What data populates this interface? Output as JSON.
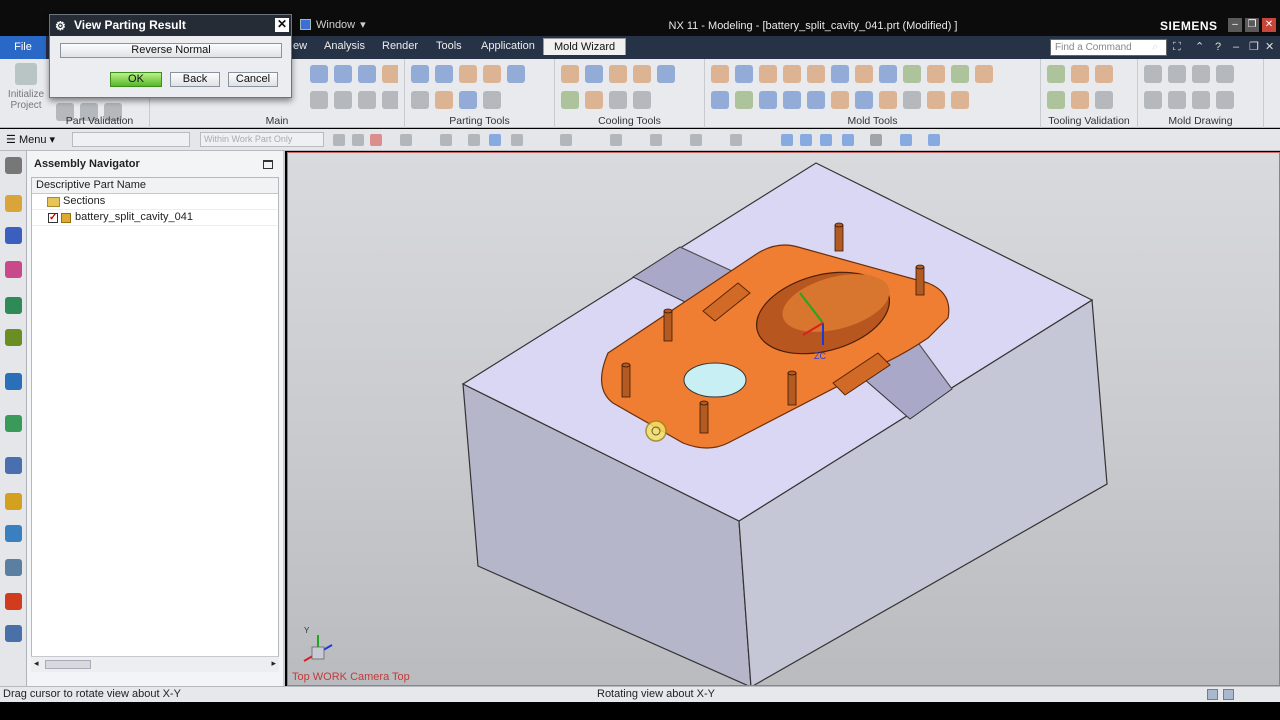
{
  "window": {
    "title": "NX 11 - Modeling - [battery_split_cavity_041.prt (Modified) ]",
    "brand": "SIEMENS",
    "window_menu": "Window",
    "window_menu_arrow": "▾",
    "minimize": "–",
    "restore": "❐",
    "close": "✕"
  },
  "dialog": {
    "title": "View Parting Result",
    "reverse_normal": "Reverse Normal",
    "ok": "OK",
    "back": "Back",
    "cancel": "Cancel"
  },
  "ribbon": {
    "file_tab": "File",
    "tabs": [
      "ew",
      "Analysis",
      "Render",
      "Tools",
      "Application",
      "Mold Wizard"
    ],
    "active_tab": "Mold Wizard",
    "find_command_placeholder": "Find a Command",
    "initialize_project": "Initialize Project",
    "groups": [
      "Part Validation",
      "Main",
      "Parting Tools",
      "Cooling Tools",
      "Mold Tools",
      "Tooling Validation",
      "Mold Drawing"
    ]
  },
  "quickbar": {
    "menu_label": "Menu",
    "selection_filter": "Within Work Part Only"
  },
  "navigator": {
    "title": "Assembly Navigator",
    "column_header": "Descriptive Part Name",
    "rows": [
      {
        "label": "Sections"
      },
      {
        "label": "battery_split_cavity_041"
      }
    ]
  },
  "viewport": {
    "camera_label": "Top WORK Camera Top",
    "triad_zc": "ZC",
    "triad_y": "Y"
  },
  "status": {
    "left": "Drag cursor to rotate view about X-Y",
    "middle": "Rotating view about X-Y"
  },
  "colors": {
    "accent_blue": "#2a68c8",
    "part_orange": "#f07e32",
    "block_face": "#d8d6f2",
    "dialog_ok": "#54b829"
  }
}
